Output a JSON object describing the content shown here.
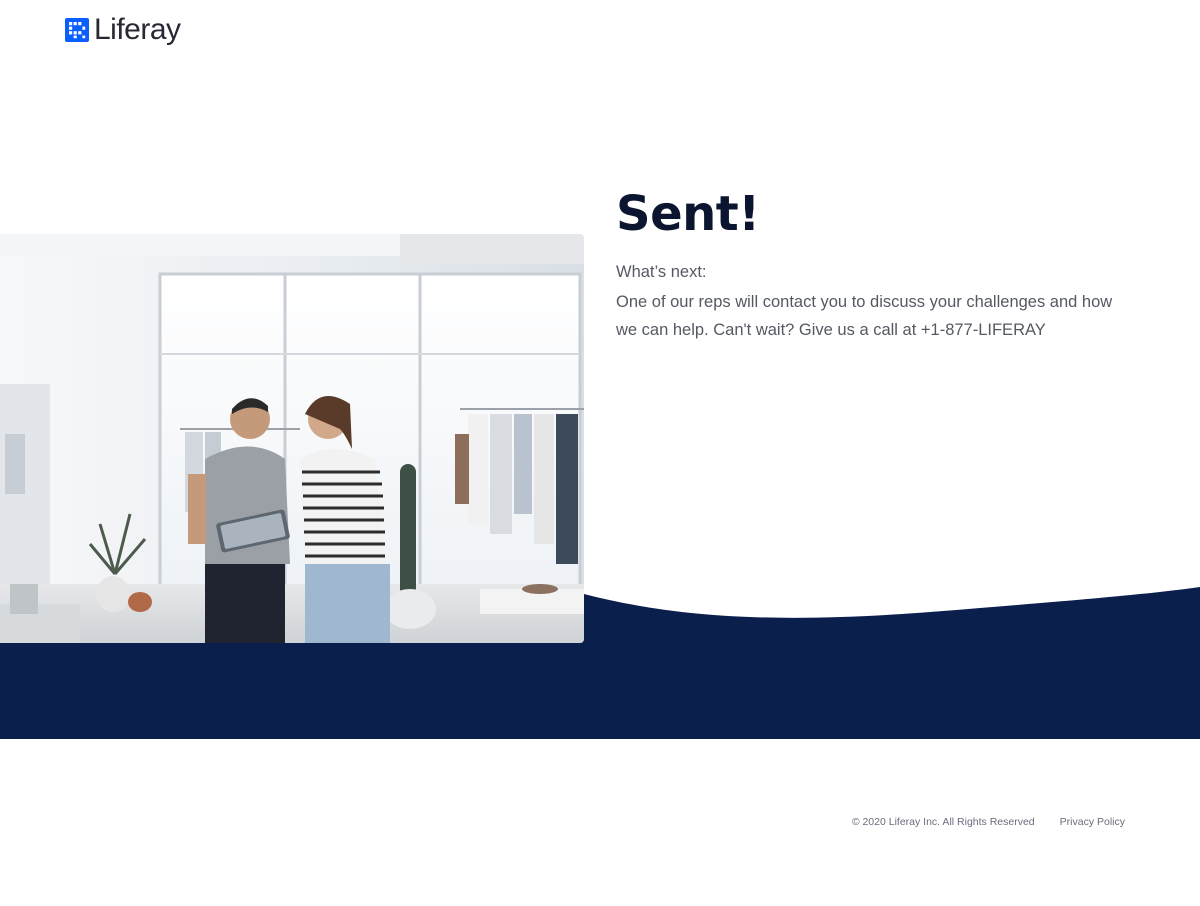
{
  "header": {
    "logo_text": "Liferay",
    "logo_icon": "liferay-logo-icon"
  },
  "hero": {
    "image_description": "shop-photo",
    "heading": "Sent!",
    "next_label": "What’s next:",
    "message": "One of our reps will contact you to discuss your challenges and how we can help. Can't wait? Give us a call at +1-877-LIFERAY"
  },
  "footer": {
    "copyright": "© 2020 Liferay Inc. All Rights Reserved",
    "privacy_link": "Privacy Policy"
  },
  "colors": {
    "navy": "#0b1f4d",
    "brand_blue": "#0b5fff",
    "heading": "#0b1530",
    "body_text": "#555963"
  }
}
